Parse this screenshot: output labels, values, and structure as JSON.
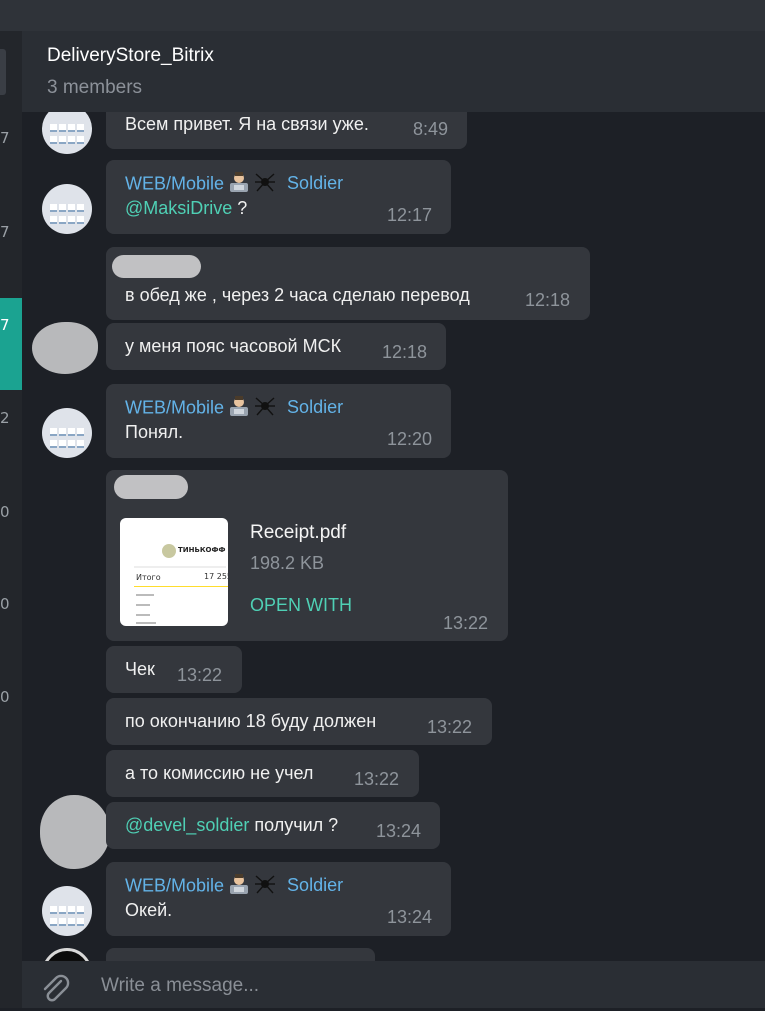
{
  "chat": {
    "title": "DeliveryStore_Bitrix",
    "subtitle": "3 members"
  },
  "sidebar": {
    "numbers": [
      "7",
      "7",
      "7",
      "2",
      "0",
      "0",
      "0"
    ],
    "active_index": 2
  },
  "messages": [
    {
      "type": "text",
      "text": "Всем привет. Я на связи уже.",
      "time": "8:49",
      "avatar": "web"
    },
    {
      "type": "named",
      "sender": "WEB/Mobile",
      "sender2": "Soldier",
      "mention": "@MaksiDrive",
      "text": " ?",
      "time": "12:17",
      "avatar": "web"
    },
    {
      "type": "named-redacted",
      "text": "в обед же , через 2 часа сделаю перевод",
      "time": "12:18"
    },
    {
      "type": "text",
      "text": "у меня пояс часовой МСК",
      "time": "12:18",
      "avatar": "blob"
    },
    {
      "type": "named",
      "sender": "WEB/Mobile",
      "sender2": "Soldier",
      "text": "Понял.",
      "time": "12:20",
      "avatar": "web"
    },
    {
      "type": "file",
      "file_name": "Receipt.pdf",
      "file_size": "198.2 KB",
      "action": "OPEN WITH",
      "time": "13:22"
    },
    {
      "type": "text",
      "text": "Чек",
      "time": "13:22"
    },
    {
      "type": "text",
      "text": "по окончанию 18 буду должен",
      "time": "13:22"
    },
    {
      "type": "text",
      "text": "а то комиссию не учел",
      "time": "13:22"
    },
    {
      "type": "mention",
      "mention": "@devel_soldier",
      "text": " получил ?",
      "time": "13:24",
      "avatar": "blob"
    },
    {
      "type": "named",
      "sender": "WEB/Mobile",
      "sender2": "Soldier",
      "text": "Окей.",
      "time": "13:24",
      "avatar": "web"
    }
  ],
  "receipt_thumb": {
    "brand": "ТИНЬКОФФ",
    "total_label": "Итого",
    "total_value": "17 255"
  },
  "composer": {
    "placeholder": "Write a message..."
  },
  "icons": {
    "attach": "paperclip-icon",
    "sender_emoji_1": "technologist-emoji-icon",
    "sender_emoji_2": "spider-emoji-icon"
  },
  "colors": {
    "accent": "#1ba391",
    "link": "#63b3e8",
    "mention": "#4fd0b5",
    "bubble": "#34373d",
    "background": "#1d2026"
  }
}
